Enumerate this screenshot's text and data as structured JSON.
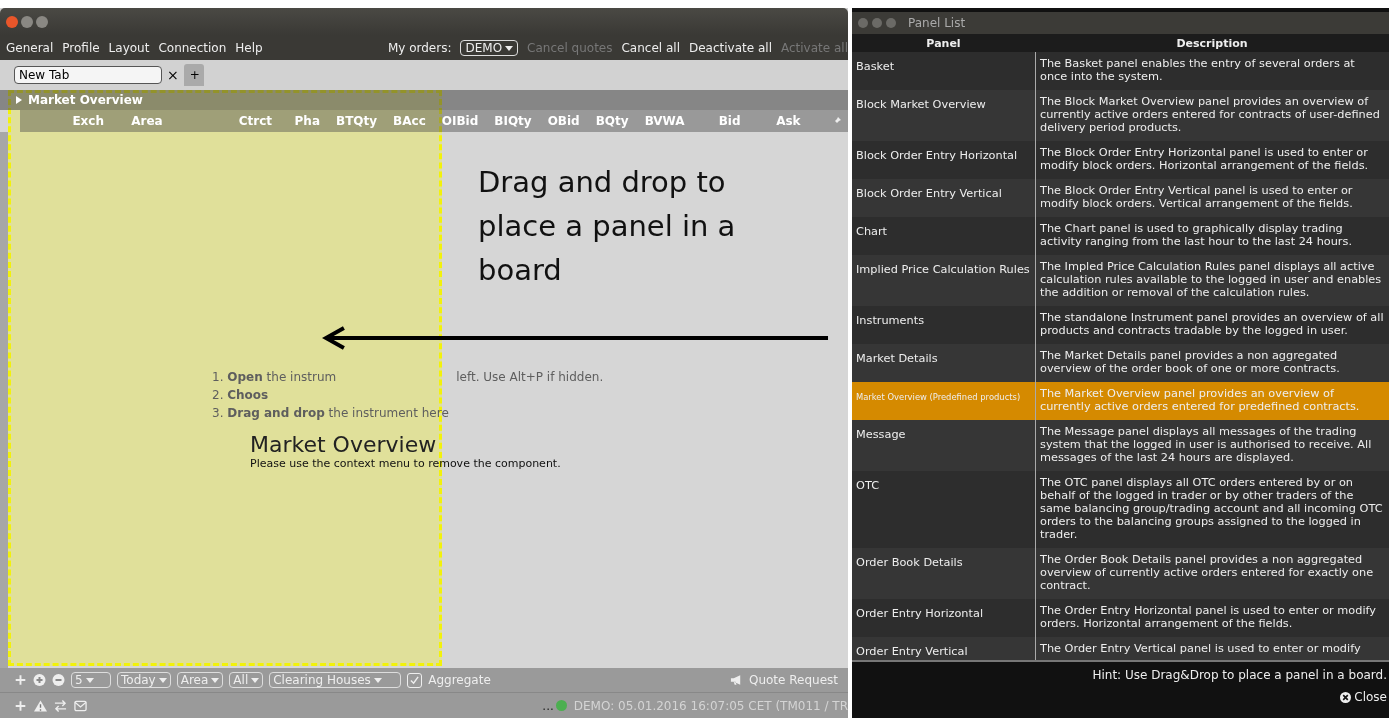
{
  "main_window": {
    "menu": [
      "General",
      "Profile",
      "Layout",
      "Connection",
      "Help"
    ],
    "my_orders_label": "My orders:",
    "account": "DEMO",
    "actions": [
      {
        "label": "Cancel quotes",
        "disabled": true
      },
      {
        "label": "Cancel all",
        "disabled": false
      },
      {
        "label": "Deactivate all",
        "disabled": false
      },
      {
        "label": "Activate all",
        "disabled": true
      }
    ],
    "tabs": [
      {
        "label": "New Tab",
        "selected": true
      }
    ],
    "close_tab": "×",
    "add_tab": "+",
    "board": {
      "title": "Market Overview",
      "expanded": false,
      "columns": [
        "Exch",
        "Area",
        "Ctrct",
        "Pha",
        "BTQty",
        "BAcc",
        "OIBid",
        "BIQty",
        "OBid",
        "BQty",
        "BVWA",
        "Bid",
        "Ask"
      ],
      "drag_label": "Market Overview",
      "notice": "Please use the context menu to remove the component.",
      "instructions": [
        [
          "1. **Open** the instrum",
          "left. Use Alt+P if hidden."
        ],
        [
          "2. **Choos**"
        ],
        [
          "3. **Drag and drop** the instrument here"
        ]
      ],
      "drop_hint": "Drag and drop to place a panel in a board"
    },
    "toolbar": {
      "count": "5",
      "filters": [
        "Today",
        "Area",
        "All"
      ],
      "clearing": "Clearing Houses",
      "aggregate": {
        "label": "Aggregate",
        "checked": true
      },
      "quote_request": "Quote Request"
    },
    "status": {
      "ellipsis": "...",
      "text": "DEMO: 05.01.2016 16:07:05 CET (TM011 / TR"
    }
  },
  "panel_list": {
    "title": "Panel List",
    "columns": [
      "Panel",
      "Description"
    ],
    "rows": [
      {
        "name": "Basket",
        "description": "The Basket panel enables the entry of several orders at once into the system.",
        "selected": false
      },
      {
        "name": "Block Market Overview",
        "description": "The Block Market Overview panel provides an overview of currently active orders entered for contracts of user-defined delivery period products.",
        "selected": false
      },
      {
        "name": "Block Order Entry Horizontal",
        "description": "The Block Order Entry Horizontal panel is used to enter or modify block orders. Horizontal arrangement of the fields.",
        "selected": false
      },
      {
        "name": "Block Order Entry Vertical",
        "description": "The Block Order Entry Vertical panel is used to enter or modify block orders. Vertical arrangement of the fields.",
        "selected": false
      },
      {
        "name": "Chart",
        "description": "The Chart panel is used to graphically display trading activity ranging from the last hour to the last 24 hours.",
        "selected": false
      },
      {
        "name": "Implied Price Calculation Rules",
        "description": "The Impled Price Calculation Rules panel displays all active calculation rules available to the logged in user and enables the addition or removal of the calculation rules.",
        "selected": false
      },
      {
        "name": "Instruments",
        "description": "The standalone Instrument panel provides an overview of all products and contracts tradable by the logged in user.",
        "selected": false
      },
      {
        "name": "Market Details",
        "description": "The Market Details panel provides a non aggregated overview of the order book of one or more contracts.",
        "selected": false
      },
      {
        "name": "Market Overview (Predefined products)",
        "description": "The Market Overview panel provides an overview of currently active orders entered for predefined contracts.",
        "selected": true
      },
      {
        "name": "Message",
        "description": "The Message panel displays all messages of the trading system that the logged in user is authorised to receive. All messages of the last 24 hours are displayed.",
        "selected": false
      },
      {
        "name": "OTC",
        "description": "The OTC panel displays all OTC orders entered by or on behalf of the logged in trader or by other traders of the same balancing group/trading account and all incoming OTC orders to the balancing groups assigned to the logged in trader.",
        "selected": false
      },
      {
        "name": "Order Book Details",
        "description": "The Order Book Details panel provides a non aggregated overview of currently active orders entered for exactly one contract.",
        "selected": false
      },
      {
        "name": "Order Entry Horizontal",
        "description": "The Order Entry Horizontal panel is used to enter or modify orders. Horizontal arrangement of the fields.",
        "selected": false
      },
      {
        "name": "Order Entry Vertical",
        "description": "The Order Entry Vertical panel is used to enter or modify",
        "selected": false
      }
    ],
    "hint": "Hint: Use Drag&Drop to place a panel in a board.",
    "close": "Close"
  }
}
